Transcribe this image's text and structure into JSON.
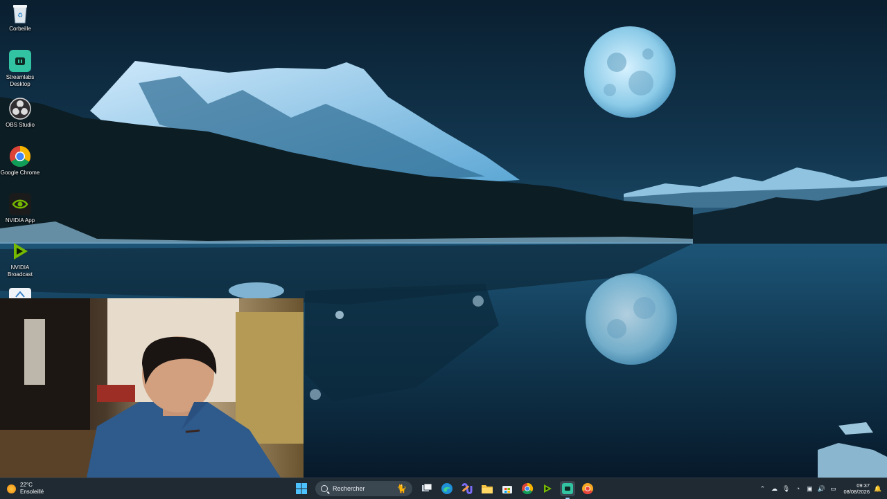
{
  "desktop": {
    "icons": [
      {
        "label": "Corbeille",
        "icon": "recycle-bin-icon"
      },
      {
        "label": "Streamlabs Desktop",
        "icon": "streamlabs-icon"
      },
      {
        "label": "OBS Studio",
        "icon": "obs-icon"
      },
      {
        "label": "Google Chrome",
        "icon": "chrome-icon"
      },
      {
        "label": "NVIDIA App",
        "icon": "nvidia-icon"
      },
      {
        "label": "NVIDIA Broadcast",
        "icon": "nvidia-broadcast-icon"
      }
    ]
  },
  "taskbar": {
    "weather": {
      "temperature": "22°C",
      "condition": "Ensoleillé"
    },
    "search_placeholder": "Recherche",
    "search_label": "Rechercher",
    "pinned": [
      "start-icon",
      "task-view-icon",
      "edge-icon",
      "copilot-icon",
      "file-explorer-icon",
      "store-icon",
      "chrome-icon",
      "nvidia-broadcast-icon",
      "streamlabs-icon",
      "chrome-dev-icon"
    ],
    "clock": {
      "time": "09:37",
      "date": "08/08/2026"
    }
  },
  "colors": {
    "taskbar": "#1f2a33",
    "accent": "#9ad0ff",
    "sky": "#0d2a3e"
  }
}
